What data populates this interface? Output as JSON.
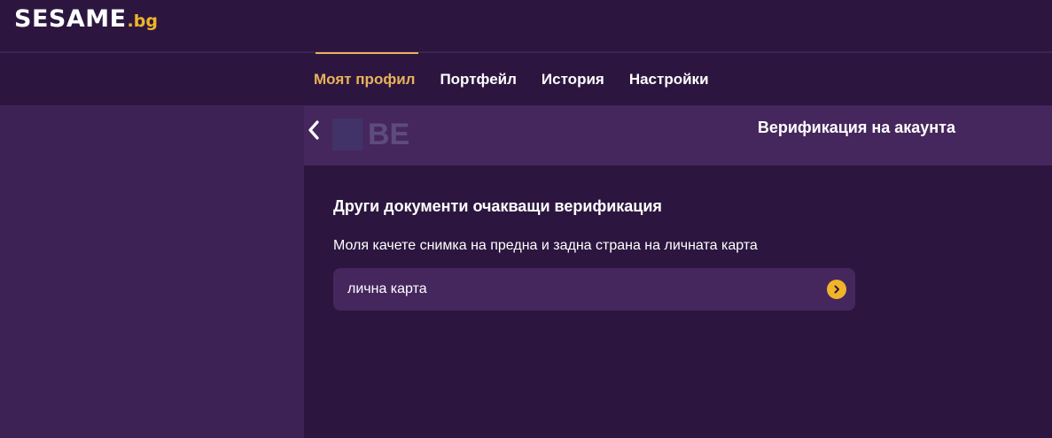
{
  "header": {
    "logo_main": "SESAME",
    "logo_tld": ".bg"
  },
  "nav": {
    "tabs": [
      {
        "label": "Моят профил",
        "active": true
      },
      {
        "label": "Портфейл",
        "active": false
      },
      {
        "label": "История",
        "active": false
      },
      {
        "label": "Настройки",
        "active": false
      }
    ]
  },
  "sub_header": {
    "faded_logo_text": "BE",
    "title": "Верификация на акаунта"
  },
  "content": {
    "heading": "Други документи очакващи верификация",
    "instructions": "Моля качете снимка на предна и задна страна на личната карта",
    "documents": [
      {
        "label": "лична карта"
      }
    ]
  },
  "colors": {
    "accent": "#f0b429",
    "active_tab": "#e9b25a",
    "background": "#3d2355",
    "panel": "#2c163f",
    "item": "#45275e"
  },
  "icons": {
    "back": "chevron-left-icon",
    "item_arrow": "chevron-right-circle-icon"
  }
}
